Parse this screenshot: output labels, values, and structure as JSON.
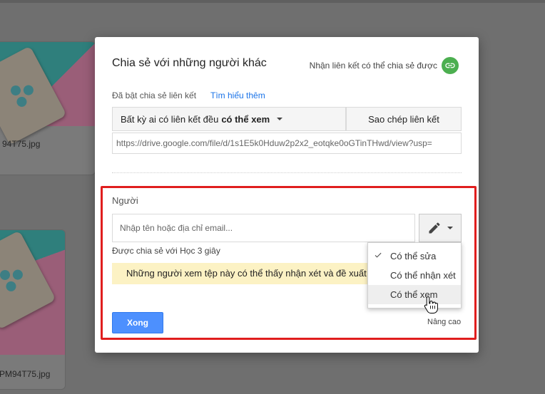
{
  "background": {
    "files": [
      {
        "name": "94T75.jpg"
      },
      {
        "name": "PM94T75.jpg"
      }
    ]
  },
  "dialog": {
    "title": "Chia sẻ với những người khác",
    "get_link_label": "Nhận liên kết có thể chia sẻ được",
    "link_sharing_on": "Đã bật chia sẻ liên kết",
    "learn_more": "Tìm hiểu thêm",
    "access": {
      "prefix": "Bất kỳ ai có liên kết đều",
      "level": "có thể xem"
    },
    "copy_link": "Sao chép liên kết",
    "url": "https://drive.google.com/file/d/1s1E5k0Hduw2p2x2_eotqke0oGTinTHwd/view?usp=",
    "people_label": "Người",
    "people_placeholder": "Nhập tên hoặc địa chỉ email...",
    "shared_with": "Được chia sẻ với Học 3 giây",
    "warning": "Những người xem tệp này có thể thấy nhận xét và đề xuất",
    "done": "Xong",
    "advanced": "Nâng cao"
  },
  "permission_menu": {
    "items": [
      {
        "label": "Có thể sửa",
        "checked": true
      },
      {
        "label": "Có thể nhận xét",
        "checked": false
      },
      {
        "label": "Có thể xem",
        "checked": false
      }
    ]
  },
  "colors": {
    "highlight": "#e01e1e",
    "link_icon": "#4caf50",
    "done_button": "#4d90fe",
    "warning_bg": "#fcf2c4",
    "learn_more": "#1a73e8"
  }
}
